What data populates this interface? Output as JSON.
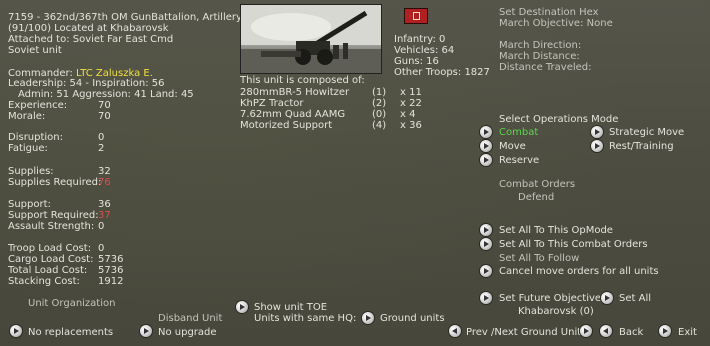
{
  "unit": {
    "title": "7159 - 362nd/367th OM GunBattalion, Artillery Uı",
    "location": "(91/100) Located at Khabarovsk",
    "attached": "Attached to: Soviet Far East Cmd",
    "nation": "Soviet unit"
  },
  "commander": {
    "label": "Commander:",
    "name": "LTC Zaluszka E.",
    "leadership": "Leadership: 54 - Inspiration: 56",
    "stats": "Admin: 51  Aggression: 41 Land: 45"
  },
  "stats": [
    {
      "label": "Experience:",
      "value": "70",
      "red": false
    },
    {
      "label": "Morale:",
      "value": "70",
      "red": false
    },
    {
      "label": "Disruption:",
      "value": "0",
      "red": false
    },
    {
      "label": "Fatigue:",
      "value": "2",
      "red": false
    },
    {
      "label": "Supplies:",
      "value": "32",
      "red": false
    },
    {
      "label": "Supplies Required:",
      "value": "76",
      "red": true
    },
    {
      "label": "Support:",
      "value": "36",
      "red": false
    },
    {
      "label": "Support Required:",
      "value": "37",
      "red": true
    },
    {
      "label": "Assault Strength:",
      "value": "0",
      "red": false
    },
    {
      "label": "Troop Load Cost:",
      "value": "0",
      "red": false
    },
    {
      "label": "Cargo Load Cost:",
      "value": "5736",
      "red": false
    },
    {
      "label": "Total Load Cost:",
      "value": "5736",
      "red": false
    },
    {
      "label": "Stacking Cost:",
      "value": "1912",
      "red": false
    }
  ],
  "composition": {
    "header": "This unit is composed of:",
    "items": [
      {
        "name": "280mmBR-5 Howitzer",
        "damaged": "(1)",
        "count": "x 11"
      },
      {
        "name": "KhPZ Tractor",
        "damaged": "(2)",
        "count": "x 22"
      },
      {
        "name": "7.62mm Quad AAMG",
        "damaged": "(0)",
        "count": "x 4"
      },
      {
        "name": "Motorized Support",
        "damaged": "(4)",
        "count": "x 36"
      }
    ]
  },
  "totals": {
    "infantry": "Infantry: 0",
    "vehicles": "Vehicles: 64",
    "guns": "Guns: 16",
    "other": "Other Troops: 1827"
  },
  "march": {
    "destination": "Set Destination Hex",
    "objective": "March Objective: None",
    "direction": "March Direction:",
    "distance": "March Distance:",
    "traveled": "Distance Traveled:"
  },
  "opmode": {
    "header": "Select Operations Mode",
    "combat": "Combat",
    "strategic": "Strategic Move",
    "move": "Move",
    "rest": "Rest/Training",
    "reserve": "Reserve"
  },
  "orders": {
    "header": "Combat Orders",
    "value": "Defend"
  },
  "actions": {
    "set_opmode": "Set All To This OpMode",
    "set_orders": "Set All To This Combat Orders",
    "set_follow": "Set All To Follow",
    "cancel_move": "Cancel move orders for all units",
    "future_obj": "Set Future Objective",
    "set_all": "Set All",
    "khabarovsk": "Khabarovsk (0)"
  },
  "bottom": {
    "unit_org": "Unit Organization",
    "disband": "Disband Unit",
    "show_toe": "Show unit TOE",
    "same_hq": "Units with same HQ:",
    "ground_units": "Ground units",
    "no_replacements": "No replacements",
    "no_upgrade": "No upgrade",
    "prev_next": "Prev /Next Ground Unit",
    "back": "Back",
    "exit": "Exit"
  },
  "colors": {
    "background": "#4c4c40",
    "text": "#e4e4dc",
    "commander": "#f0e040",
    "warning": "#d85050",
    "selected_mode": "#5ad84a"
  }
}
